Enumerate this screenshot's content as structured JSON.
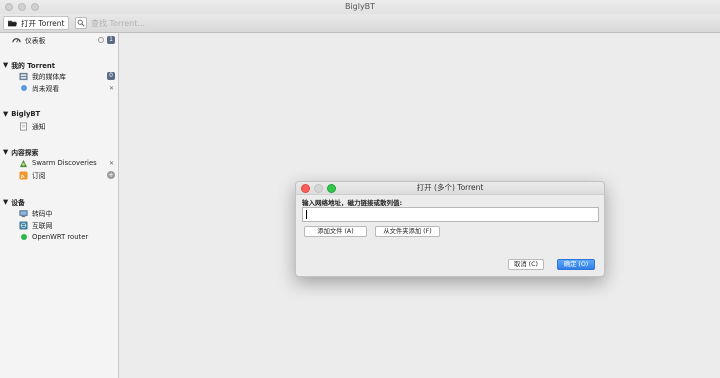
{
  "window": {
    "title": "BiglyBT"
  },
  "toolbar": {
    "open_label": "打开 Torrent",
    "search_placeholder": "查找 Torrent..."
  },
  "sidebar": {
    "dashboard": {
      "label": "仪表板",
      "badge": "1"
    },
    "sections": [
      {
        "label": "我的 Torrent"
      },
      {
        "label": "BiglyBT"
      },
      {
        "label": "内容探索"
      },
      {
        "label": "设备"
      }
    ],
    "items": {
      "library": {
        "label": "我的媒体库",
        "badge": "0"
      },
      "unwatched": {
        "label": "尚未观看"
      },
      "notifications": {
        "label": "通知"
      },
      "swarm": {
        "label": "Swarm Discoveries"
      },
      "subscriptions": {
        "label": "订阅"
      },
      "transcoding": {
        "label": "转码中"
      },
      "internet": {
        "label": "互联网"
      },
      "openwrt": {
        "label": "OpenWRT router"
      }
    }
  },
  "dialog": {
    "title": "打开 (多个) Torrent",
    "prompt": "输入网络地址，磁力链接或散列值:",
    "url_value": "",
    "add_file_label": "添加文件 (A)",
    "add_folder_label": "从文件夹添加 (F)",
    "cancel_label": "取消 (C)",
    "ok_label": "确定 (O)"
  },
  "colors": {
    "accent": "#2f7fe8",
    "badge": "#5a6a84",
    "online_dot": "#2bb84a",
    "unwatched_dot": "#5b9be0"
  }
}
